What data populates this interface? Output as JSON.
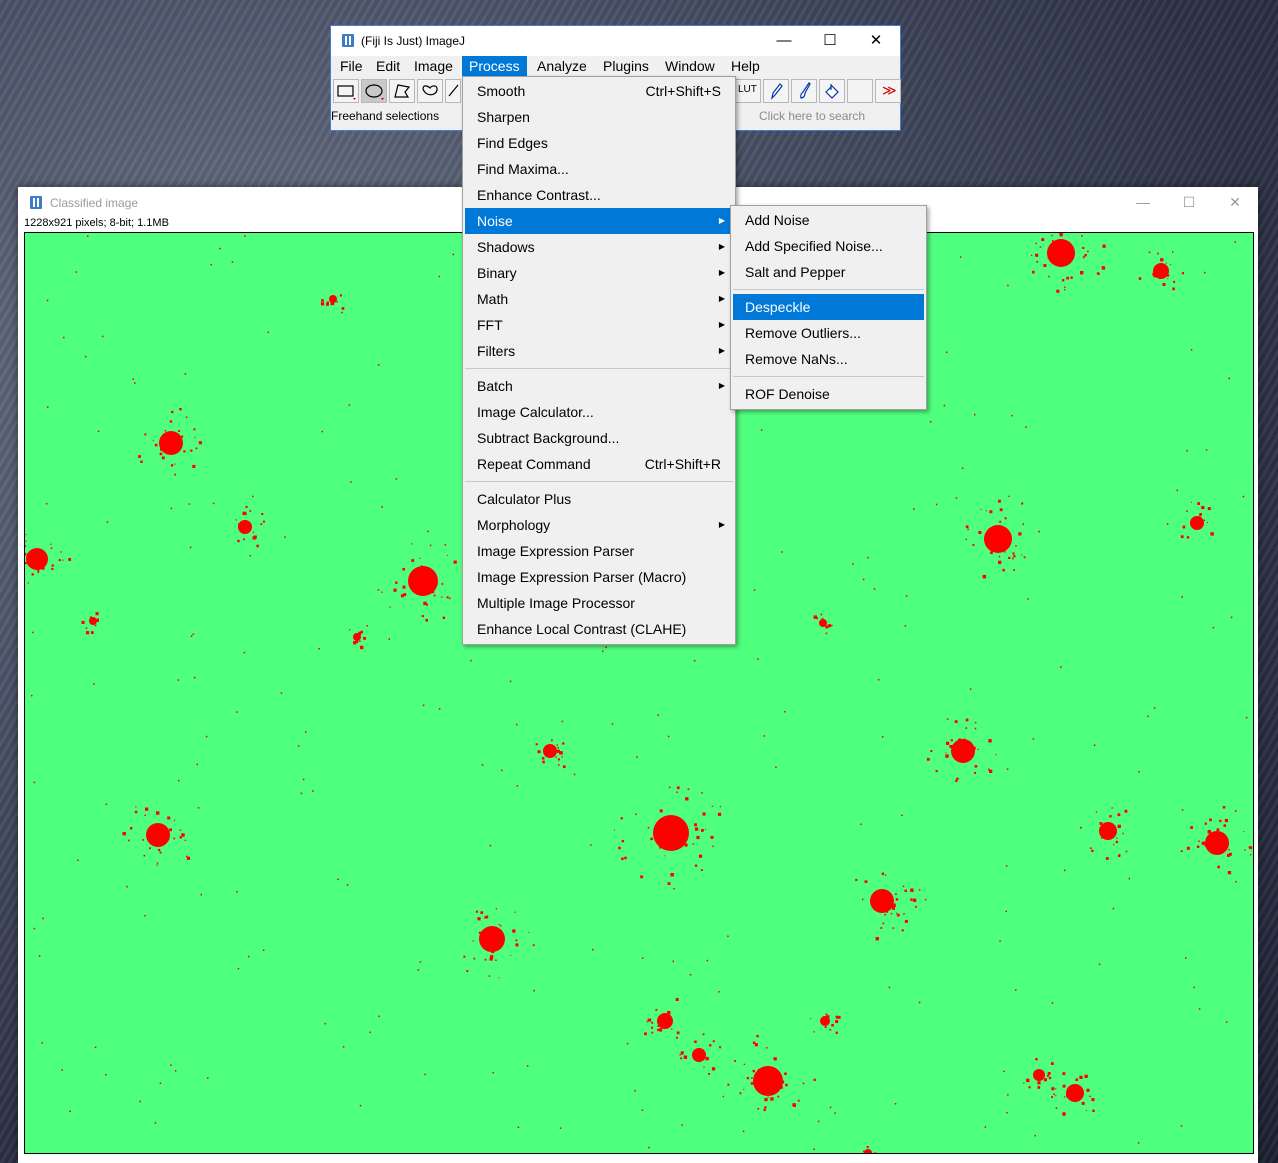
{
  "image_window": {
    "title": "Classified image",
    "info": "1228x921 pixels; 8-bit; 1.1MB",
    "background_color": "#4fff7e",
    "blob_color": "#ff0000",
    "controls": [
      "minimize",
      "maximize",
      "close"
    ]
  },
  "fiji_window": {
    "title": "(Fiji Is Just) ImageJ",
    "menubar": [
      "File",
      "Edit",
      "Image",
      "Process",
      "Analyze",
      "Plugins",
      "Window",
      "Help"
    ],
    "active_menu": "Process",
    "status_text": "Freehand selections",
    "search_placeholder": "Click here to search",
    "tools_left": [
      "rectangle-tool-icon",
      "oval-tool-icon",
      "polygon-tool-icon",
      "freehand-tool-icon",
      "line-tool-icon"
    ],
    "tools_right": [
      "LUT",
      "pencil-tool-icon",
      "brush-tool-icon",
      "flood-fill-tool-icon",
      "blank-tool",
      "more-tools-icon"
    ],
    "lut_label": "LUT",
    "more_label": "≫"
  },
  "process_menu": {
    "groups": [
      [
        {
          "label": "Smooth",
          "shortcut": "Ctrl+Shift+S"
        },
        {
          "label": "Sharpen"
        },
        {
          "label": "Find Edges"
        },
        {
          "label": "Find Maxima..."
        },
        {
          "label": "Enhance Contrast..."
        },
        {
          "label": "Noise",
          "submenu": true,
          "highlighted": true
        },
        {
          "label": "Shadows",
          "submenu": true
        },
        {
          "label": "Binary",
          "submenu": true
        },
        {
          "label": "Math",
          "submenu": true
        },
        {
          "label": "FFT",
          "submenu": true
        },
        {
          "label": "Filters",
          "submenu": true
        }
      ],
      [
        {
          "label": "Batch",
          "submenu": true
        },
        {
          "label": "Image Calculator..."
        },
        {
          "label": "Subtract Background..."
        },
        {
          "label": "Repeat Command",
          "shortcut": "Ctrl+Shift+R"
        }
      ],
      [
        {
          "label": "Calculator Plus"
        },
        {
          "label": "Morphology",
          "submenu": true
        },
        {
          "label": "Image Expression Parser"
        },
        {
          "label": "Image Expression Parser (Macro)"
        },
        {
          "label": "Multiple Image Processor"
        },
        {
          "label": "Enhance Local Contrast (CLAHE)"
        }
      ]
    ]
  },
  "noise_submenu": {
    "groups": [
      [
        {
          "label": "Add Noise"
        },
        {
          "label": "Add Specified Noise..."
        },
        {
          "label": "Salt and Pepper"
        }
      ],
      [
        {
          "label": "Despeckle",
          "highlighted": true
        },
        {
          "label": "Remove Outliers..."
        },
        {
          "label": "Remove NaNs..."
        }
      ],
      [
        {
          "label": "ROF Denoise"
        }
      ]
    ]
  },
  "accent_color": "#0078d7"
}
